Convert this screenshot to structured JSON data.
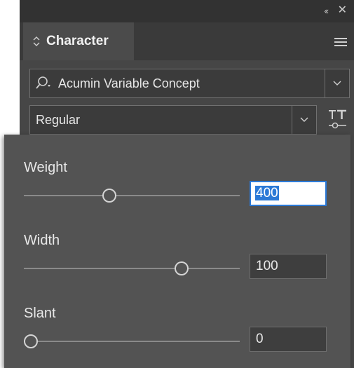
{
  "panel": {
    "tab_title": "Character",
    "font_family": "Acumin Variable Concept",
    "font_style": "Regular"
  },
  "axes": [
    {
      "label": "Weight",
      "value": "400",
      "slider_fraction": 0.39,
      "focused": true
    },
    {
      "label": "Width",
      "value": "100",
      "slider_fraction": 0.75,
      "focused": false
    },
    {
      "label": "Slant",
      "value": "0",
      "slider_fraction": 0.0,
      "focused": false
    }
  ],
  "colors": {
    "panel_bg": "#464646",
    "flyout_bg": "#535353",
    "focus_blue": "#2b79d6"
  },
  "icons": [
    "collapse-icon",
    "close-icon",
    "tab-updown-icon",
    "panel-menu-icon",
    "search-icon",
    "chevron-down-icon",
    "variable-font-icon"
  ]
}
